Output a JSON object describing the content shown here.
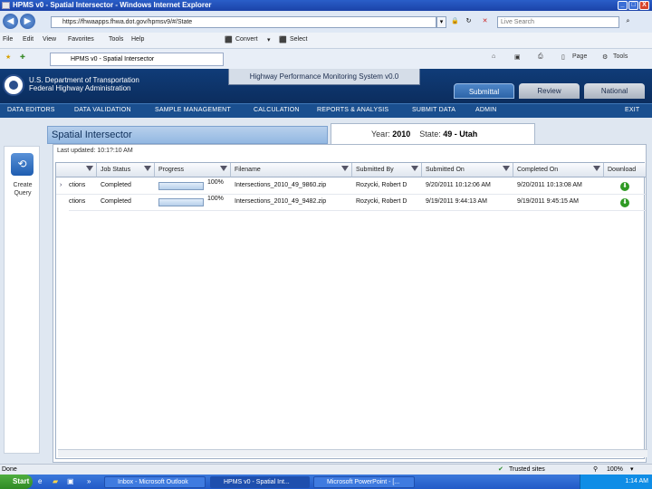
{
  "window": {
    "title": "HPMS v0 - Spatial Intersector - Windows Internet Explorer",
    "minimize": "_",
    "maximize": "□",
    "close": "X"
  },
  "address": {
    "url": "https://fhwaapps.fhwa.dot.gov/hpmsv9/#/State",
    "search_placeholder": "Live Search"
  },
  "menu": {
    "items": [
      "File",
      "Edit",
      "View",
      "Favorites",
      "Tools",
      "Help"
    ],
    "convert": "Convert",
    "select": "Select"
  },
  "tab": {
    "label": "HPMS v0 - Spatial Intersector",
    "page": "Page",
    "tools": "Tools"
  },
  "banner": {
    "agency_line1": "U.S. Department of Transportation",
    "agency_line2": "Federal Highway Administration",
    "system_title": "Highway Performance Monitoring System v0.0",
    "tabs": [
      {
        "label": "Submittal"
      },
      {
        "label": "Review"
      },
      {
        "label": "National"
      }
    ]
  },
  "nav": {
    "items": [
      "DATA EDITORS",
      "DATA VALIDATION",
      "SAMPLE MANAGEMENT",
      "CALCULATION",
      "REPORTS & ANALYSIS",
      "SUBMIT DATA",
      "ADMIN"
    ],
    "exit": "EXIT"
  },
  "sidebar": {
    "create_query": "Create Query"
  },
  "panel": {
    "title": "Spatial Intersector",
    "year_label": "Year:",
    "year_value": "2010",
    "state_label": "State:",
    "state_value": "49 - Utah",
    "last_updated": "Last updated: 10:1?:10 AM"
  },
  "grid": {
    "columns": [
      "Job Status",
      "Progress",
      "Filename",
      "Submitted By",
      "Submitted On",
      "Completed On",
      "Download"
    ],
    "rows": [
      {
        "name": "ctions",
        "status": "Completed",
        "progress": 100,
        "progress_label": "100%",
        "filename": "Intersections_2010_49_9860.zip",
        "submitted_by": "Rozycki, Robert D",
        "submitted_on": "9/20/2011 10:12:06 AM",
        "completed_on": "9/20/2011 10:13:08 AM"
      },
      {
        "name": "ctions",
        "status": "Completed",
        "progress": 100,
        "progress_label": "100%",
        "filename": "Intersections_2010_49_9482.zip",
        "submitted_by": "Rozycki, Robert D",
        "submitted_on": "9/19/2011 9:44:13 AM",
        "completed_on": "9/19/2011 9:45:15 AM"
      }
    ]
  },
  "statusbar": {
    "left": "Done",
    "zone": "Trusted sites",
    "zoom": "100%"
  },
  "taskbar": {
    "start": "Start",
    "items": [
      "Inbox - Microsoft Outlook",
      "HPMS v0 - Spatial Int...",
      "Microsoft PowerPoint - [..."
    ],
    "clock": "1:14 AM"
  }
}
